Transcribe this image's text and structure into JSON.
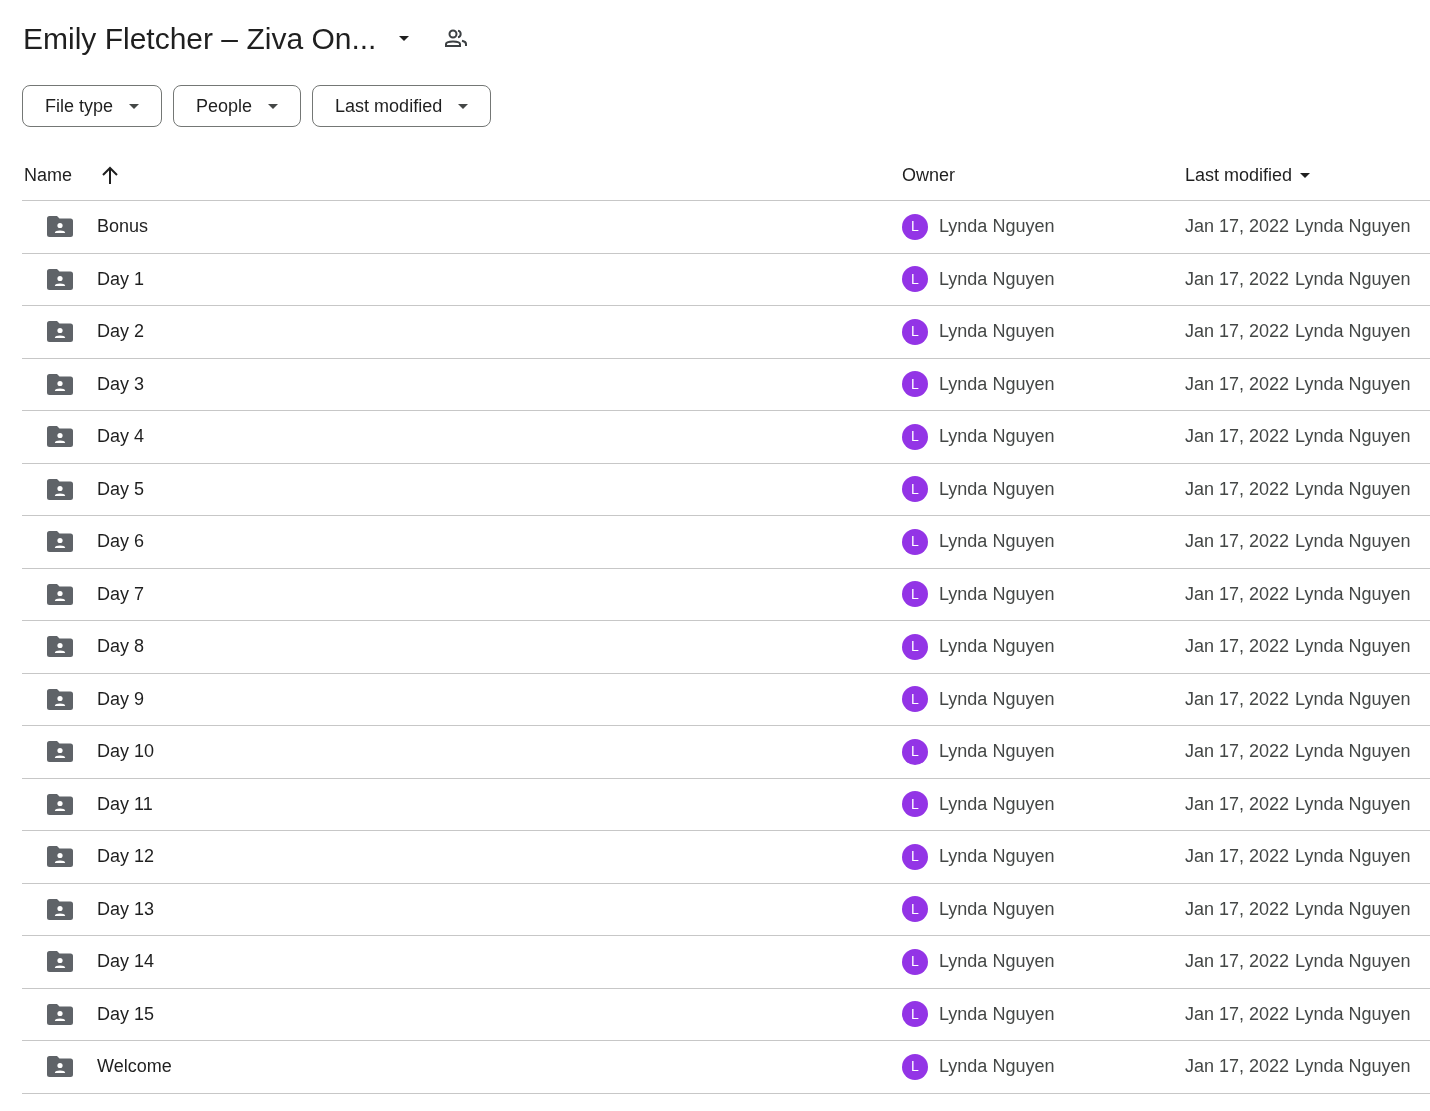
{
  "title": "Emily Fletcher – Ziva On...",
  "filters": [
    "File type",
    "People",
    "Last modified"
  ],
  "columns": {
    "name": "Name",
    "owner": "Owner",
    "modified": "Last modified"
  },
  "rows": [
    {
      "name": "Bonus",
      "owner": "Lynda Nguyen",
      "avatar": "L",
      "modified": "Jan 17, 2022",
      "modified_by": "Lynda Nguyen"
    },
    {
      "name": "Day 1",
      "owner": "Lynda Nguyen",
      "avatar": "L",
      "modified": "Jan 17, 2022",
      "modified_by": "Lynda Nguyen"
    },
    {
      "name": "Day 2",
      "owner": "Lynda Nguyen",
      "avatar": "L",
      "modified": "Jan 17, 2022",
      "modified_by": "Lynda Nguyen"
    },
    {
      "name": "Day 3",
      "owner": "Lynda Nguyen",
      "avatar": "L",
      "modified": "Jan 17, 2022",
      "modified_by": "Lynda Nguyen"
    },
    {
      "name": "Day 4",
      "owner": "Lynda Nguyen",
      "avatar": "L",
      "modified": "Jan 17, 2022",
      "modified_by": "Lynda Nguyen"
    },
    {
      "name": "Day 5",
      "owner": "Lynda Nguyen",
      "avatar": "L",
      "modified": "Jan 17, 2022",
      "modified_by": "Lynda Nguyen"
    },
    {
      "name": "Day 6",
      "owner": "Lynda Nguyen",
      "avatar": "L",
      "modified": "Jan 17, 2022",
      "modified_by": "Lynda Nguyen"
    },
    {
      "name": "Day 7",
      "owner": "Lynda Nguyen",
      "avatar": "L",
      "modified": "Jan 17, 2022",
      "modified_by": "Lynda Nguyen"
    },
    {
      "name": "Day 8",
      "owner": "Lynda Nguyen",
      "avatar": "L",
      "modified": "Jan 17, 2022",
      "modified_by": "Lynda Nguyen"
    },
    {
      "name": "Day 9",
      "owner": "Lynda Nguyen",
      "avatar": "L",
      "modified": "Jan 17, 2022",
      "modified_by": "Lynda Nguyen"
    },
    {
      "name": "Day 10",
      "owner": "Lynda Nguyen",
      "avatar": "L",
      "modified": "Jan 17, 2022",
      "modified_by": "Lynda Nguyen"
    },
    {
      "name": "Day 11",
      "owner": "Lynda Nguyen",
      "avatar": "L",
      "modified": "Jan 17, 2022",
      "modified_by": "Lynda Nguyen"
    },
    {
      "name": "Day 12",
      "owner": "Lynda Nguyen",
      "avatar": "L",
      "modified": "Jan 17, 2022",
      "modified_by": "Lynda Nguyen"
    },
    {
      "name": "Day 13",
      "owner": "Lynda Nguyen",
      "avatar": "L",
      "modified": "Jan 17, 2022",
      "modified_by": "Lynda Nguyen"
    },
    {
      "name": "Day 14",
      "owner": "Lynda Nguyen",
      "avatar": "L",
      "modified": "Jan 17, 2022",
      "modified_by": "Lynda Nguyen"
    },
    {
      "name": "Day 15",
      "owner": "Lynda Nguyen",
      "avatar": "L",
      "modified": "Jan 17, 2022",
      "modified_by": "Lynda Nguyen"
    },
    {
      "name": "Welcome",
      "owner": "Lynda Nguyen",
      "avatar": "L",
      "modified": "Jan 17, 2022",
      "modified_by": "Lynda Nguyen"
    }
  ]
}
